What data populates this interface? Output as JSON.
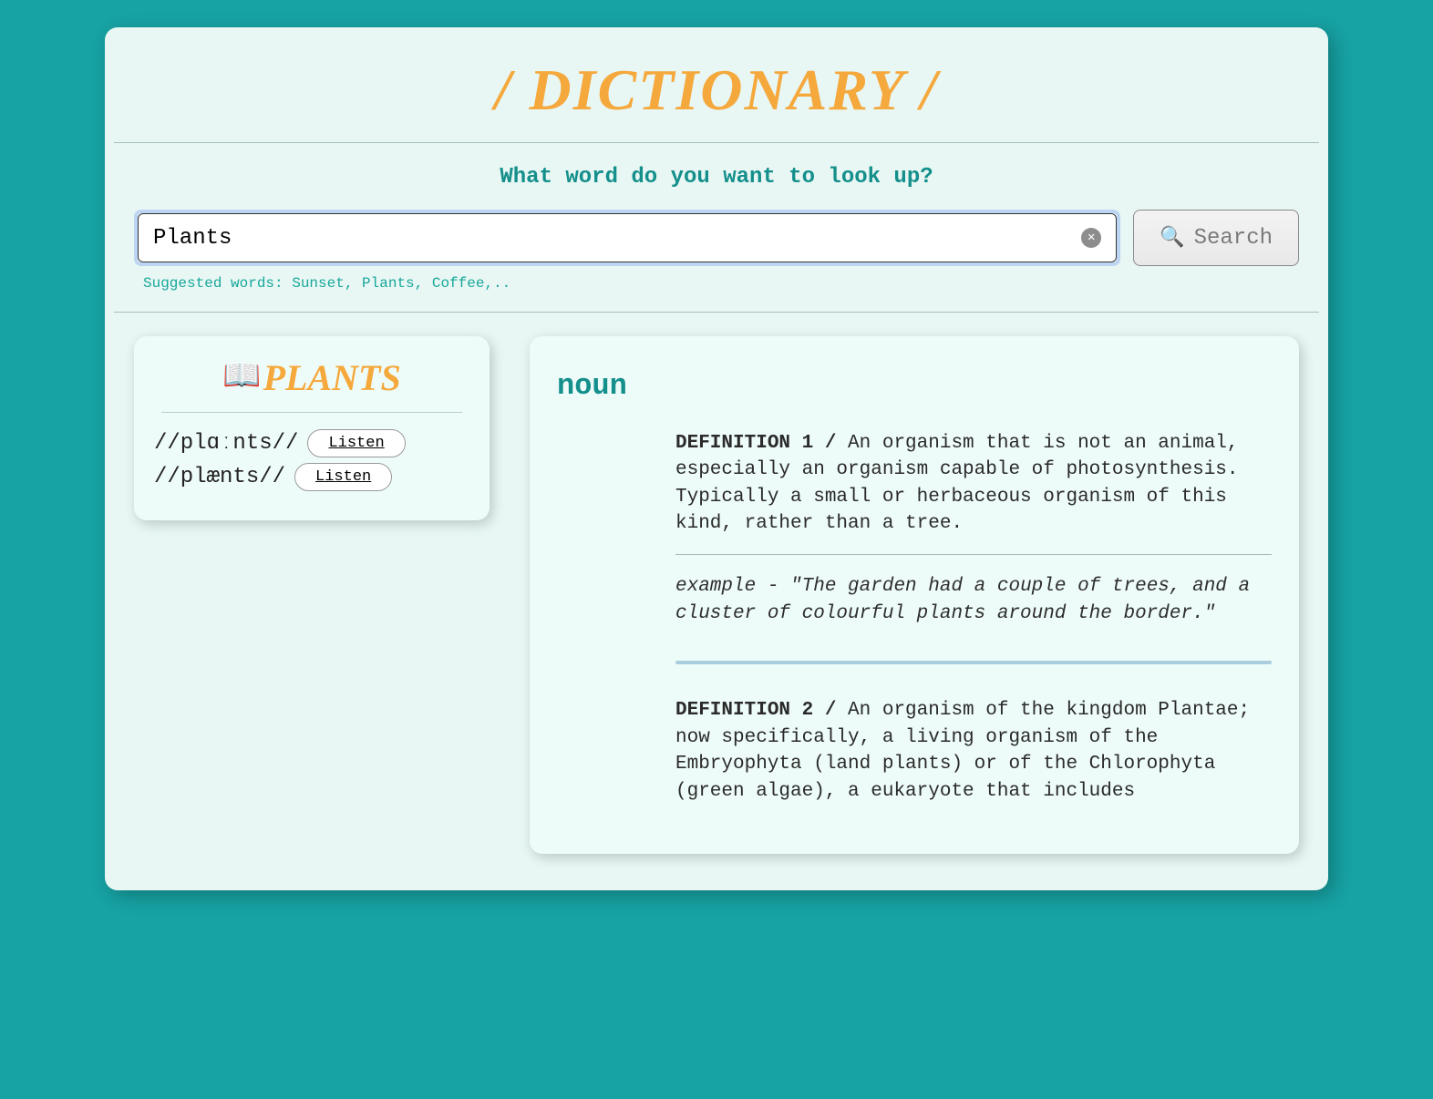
{
  "app": {
    "title": "/ Dictionary /"
  },
  "search": {
    "prompt": "What word do you want to look up?",
    "value": "Plants",
    "button_label": "Search",
    "suggestions": "Suggested words: Sunset, Plants, Coffee,.."
  },
  "word": {
    "title": "Plants",
    "pronunciations": [
      {
        "ipa": "//plɑːnts//",
        "listen": "Listen"
      },
      {
        "ipa": "//plænts//",
        "listen": "Listen"
      }
    ]
  },
  "definitions": {
    "part_of_speech": "noun",
    "entries": [
      {
        "label": "DEFINITION 1 / ",
        "text": "An organism that is not an animal, especially an organism capable of photosynthesis. Typically a small or herbaceous organism of this kind, rather than a tree.",
        "example_prefix": "example - ",
        "example": "\"The garden had a couple of trees, and a cluster of colourful plants around the border.\""
      },
      {
        "label": "DEFINITION 2 / ",
        "text": "An organism of the kingdom Plantae; now specifically, a living organism of the Embryophyta (land plants) or of the Chlorophyta (green algae), a eukaryote that includes"
      }
    ]
  }
}
